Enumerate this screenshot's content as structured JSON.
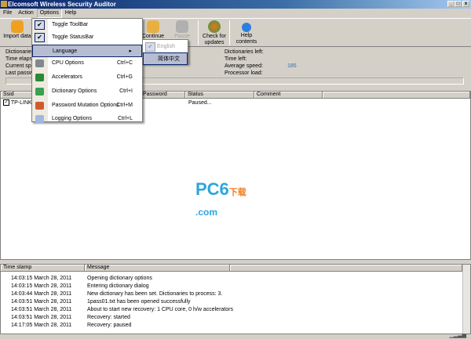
{
  "window": {
    "title": "Elcomsoft Wireless Security Auditor",
    "min": "_",
    "max": "□",
    "close": "x"
  },
  "menubar": [
    "File",
    "Action",
    "Options",
    "Help"
  ],
  "toolbar": {
    "import": "Import data",
    "continue": "Continue",
    "pause": "Pause",
    "check": "Check for updates",
    "help": "Help contents"
  },
  "info": {
    "dictionaries": "Dictionaries",
    "time_elapsed": "Time elapsed",
    "current_speed": "Current spe",
    "last_password": "Last passwo",
    "dictionaries_left": "Dictionaries left:",
    "time_left": "Time left:",
    "average_speed": "Average speed:",
    "average_speed_value": "185",
    "processor_load": "Processor load:"
  },
  "table": {
    "headers": [
      "Ssid",
      "Password",
      "Status",
      "Comment"
    ],
    "rows": [
      {
        "ssid": "TP-LINK_",
        "password": "",
        "status": "Paused...",
        "comment": ""
      }
    ]
  },
  "log": {
    "headers": [
      "Time stamp",
      "Message"
    ],
    "rows": [
      {
        "time": "14:03:15  March 28, 2011",
        "msg": "Opening dictionary options"
      },
      {
        "time": "14:03:15  March 28, 2011",
        "msg": "Entering dictionary dialog"
      },
      {
        "time": "14:03:44  March 28, 2011",
        "msg": "New dictionary has been set. Dictionaries to process: 3."
      },
      {
        "time": "14:03:51  March 28, 2011",
        "msg": "1pass01.txt has been opened successfully"
      },
      {
        "time": "14:03:51  March 28, 2011",
        "msg": "About to start new recovery: 1 CPU core, 0 h/w accelerators"
      },
      {
        "time": "14:03:51  March 28, 2011",
        "msg": "Recovery: started"
      },
      {
        "time": "14:17:05  March 28, 2011",
        "msg": "Recovery: paused"
      }
    ]
  },
  "options_menu": {
    "items": [
      {
        "label": "Toggle ToolBar",
        "shortcut": "",
        "check": "✔"
      },
      {
        "label": "Toggle StatusBar",
        "shortcut": "",
        "check": "✔"
      },
      {
        "label": "Language",
        "shortcut": "▸",
        "check": ""
      },
      {
        "label": "CPU Options",
        "shortcut": "Ctrl+C",
        "color": "#808890"
      },
      {
        "label": "Accelerators",
        "shortcut": "Ctrl+G",
        "color": "#2a8a3a"
      },
      {
        "label": "Dictionary Options",
        "shortcut": "Ctrl+I",
        "color": "#3aa050"
      },
      {
        "label": "Password Mutation Options",
        "shortcut": "Ctrl+M",
        "color": "#d05a30"
      },
      {
        "label": "Logging Options",
        "shortcut": "Ctrl+L",
        "color": "#a0b8e0"
      }
    ]
  },
  "language_menu": {
    "items": [
      "English",
      "简体中文"
    ],
    "check": "✔"
  },
  "watermark": {
    "text": "PC6",
    "suffix": ".com",
    "cn": "下载"
  }
}
